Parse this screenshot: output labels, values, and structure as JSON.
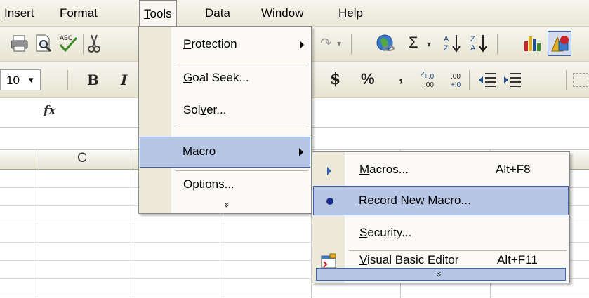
{
  "menubar": {
    "insert": "Insert",
    "format": "Format",
    "tools": "Tools",
    "data": "Data",
    "window": "Window",
    "help": "Help"
  },
  "toolbar": {
    "font_size": "10",
    "bold": "B",
    "italic": "I",
    "currency": "$",
    "percent": "%",
    "comma": ",",
    "sigma": "Σ"
  },
  "formula_bar": {
    "fx": "fx"
  },
  "grid": {
    "column_c": "C"
  },
  "tools_menu": {
    "protection": "Protection",
    "goal_seek": "Goal Seek...",
    "solver": "Solver...",
    "macro": "Macro",
    "options": "Options...",
    "expand": "»"
  },
  "macro_submenu": {
    "macros": "Macros...",
    "macros_shortcut": "Alt+F8",
    "record": "Record New Macro...",
    "security": "Security...",
    "vb_editor": "Visual Basic Editor",
    "vb_shortcut": "Alt+F11",
    "expand": "»"
  },
  "colors": {
    "highlight": "#b7c6e4",
    "highlight_border": "#3a66b4",
    "menu_bg": "#fbfaf6",
    "gutter": "#ece9d8"
  }
}
